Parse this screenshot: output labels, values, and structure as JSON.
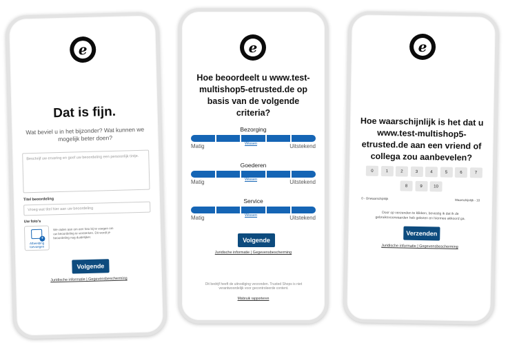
{
  "logo_letter": "e",
  "screen1": {
    "title": "Dat is fijn.",
    "subtitle": "Wat beviel u in het bijzonder? Wat kunnen we mogelijk beter doen?",
    "review_placeholder": "Beschrijf uw ervaring en geef uw beoordeling een persoonlijk tintje.",
    "title_label": "Titel beoordeling",
    "title_placeholder": "Vroeg wat titel hier aan uw beoordeling",
    "photos_label": "Uw foto's",
    "add_photo_label": "Afbeelding toevoegen",
    "photo_hint": "We raden aan om een foto bij te voegen om uw beoordeling te versterken. Dit wordt je beoordeling nog duidelijker.",
    "next_button": "Volgende",
    "footer_link": "Juridische informatie | Gegevensbescherming"
  },
  "screen2": {
    "title": "Hoe beoordeelt u www.test-multishop5-etrusted.de op basis van de volgende criteria?",
    "criteria": [
      {
        "name": "Bezorging",
        "low": "Matig",
        "high": "Uitstekend",
        "mid_link": "Wissen"
      },
      {
        "name": "Goederen",
        "low": "Matig",
        "high": "Uitstekend",
        "mid_link": "Wissen"
      },
      {
        "name": "Service",
        "low": "Matig",
        "high": "Uitstekend",
        "mid_link": "Wissen"
      }
    ],
    "next_button": "Volgende",
    "footer_link": "Juridische informatie | Gegevensbescherming",
    "notice": "Dit bedrijf heeft de uitnodiging verzonden. Trusted Shops is niet verantwoordelijk voor gecontroleerde content.",
    "report_link": "Misbruik rapporteren"
  },
  "screen3": {
    "title": "Hoe waarschijnlijk is het dat u www.test-multishop5-etrusted.de aan een vriend of collega zou aanbevelen?",
    "scale_row1": [
      "0",
      "1",
      "2",
      "3",
      "4",
      "5",
      "6",
      "7"
    ],
    "scale_row2": [
      "8",
      "9",
      "10"
    ],
    "low_label": "0 - Onwaarschijnlijk",
    "high_label": "Waarschijnlijk - 10",
    "consent": "Door op verzenden te klikken, bevestig ik dat ik de gebruiksvoorwaarden heb gelezen en hiermee akkoord ga.",
    "send_button": "Verzenden",
    "footer_link": "Juridische informatie | Gegevensbescherming"
  }
}
